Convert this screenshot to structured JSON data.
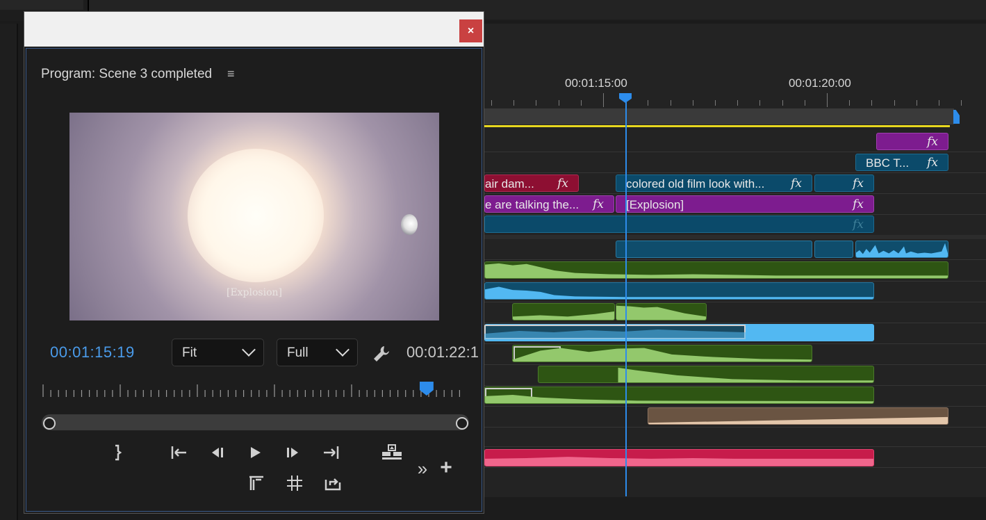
{
  "dialog": {
    "close_glyph": "×"
  },
  "monitor": {
    "title": "Program: Scene 3 completed",
    "menu_glyph": "≡",
    "video_subtitle": "[Explosion]",
    "current_timecode": "00:01:15:19",
    "fit_dropdown": "Fit",
    "resolution_dropdown": "Full",
    "duration_timecode": "00:01:22:1",
    "playhead_fraction": 0.905,
    "controls": {
      "mark_out": "mark-out-icon",
      "go_to_in": "go-to-in-icon",
      "step_back": "step-back-icon",
      "play": "play-icon",
      "step_forward": "step-forward-icon",
      "go_to_out": "go-to-out-icon",
      "lift": "lift-icon",
      "more": "»",
      "add": "+",
      "safe_margins": "safe-margins-icon",
      "grid": "grid-icon",
      "export_frame": "export-frame-icon"
    }
  },
  "timeline": {
    "ruler_labels": [
      "00:01:15:00",
      "00:01:20:00"
    ],
    "clips": {
      "bbc": "BBC T...",
      "hair_damage": "air dam...",
      "colored_film": "colored old film look with...",
      "talking": "e are talking the...",
      "explosion": "[Explosion]"
    },
    "fx_label": "fx"
  },
  "colors": {
    "accent_blue": "#2d8ceb",
    "close_red": "#c94141",
    "playhead": "#2d8ceb",
    "work_area_yellow": "#e8d81f"
  }
}
